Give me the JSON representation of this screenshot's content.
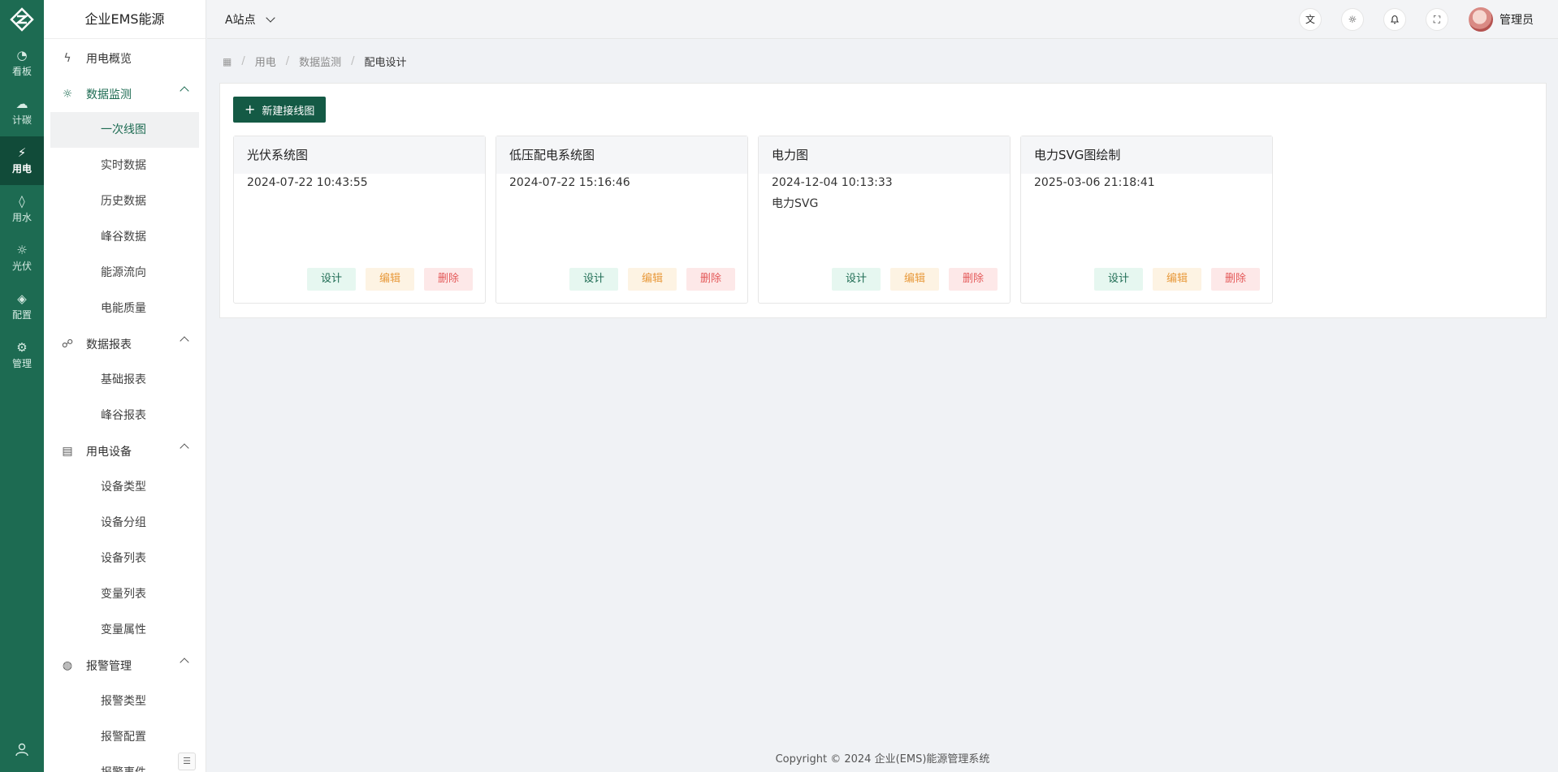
{
  "app": {
    "title": "企业EMS能源"
  },
  "rail": [
    {
      "label": "看板",
      "icon": "pie-chart-icon"
    },
    {
      "label": "计碳",
      "icon": "cloud-icon"
    },
    {
      "label": "用电",
      "icon": "plug-icon"
    },
    {
      "label": "用水",
      "icon": "water-drop-icon"
    },
    {
      "label": "光伏",
      "icon": "sun-icon"
    },
    {
      "label": "配置",
      "icon": "config-icon"
    },
    {
      "label": "管理",
      "icon": "gear-icon"
    }
  ],
  "menu": {
    "overview": "用电概览",
    "monitor": {
      "label": "数据监测",
      "items": [
        "一次线图",
        "实时数据",
        "历史数据",
        "峰谷数据",
        "能源流向",
        "电能质量"
      ]
    },
    "report": {
      "label": "数据报表",
      "items": [
        "基础报表",
        "峰谷报表"
      ]
    },
    "device": {
      "label": "用电设备",
      "items": [
        "设备类型",
        "设备分组",
        "设备列表",
        "变量列表",
        "变量属性"
      ]
    },
    "alarm": {
      "label": "报警管理",
      "items": [
        "报警类型",
        "报警配置",
        "报警事件"
      ]
    }
  },
  "header": {
    "site": "A站点",
    "user_name": "管理员"
  },
  "breadcrumb": {
    "items": [
      "用电",
      "数据监测"
    ],
    "current": "配电设计"
  },
  "toolbar": {
    "new_label": "新建接线图"
  },
  "actions": {
    "design": "设计",
    "edit": "编辑",
    "delete": "删除"
  },
  "cards": [
    {
      "title": "光伏系统图",
      "time": "2024-07-22 10:43:55",
      "desc": ""
    },
    {
      "title": "低压配电系统图",
      "time": "2024-07-22 15:16:46",
      "desc": ""
    },
    {
      "title": "电力图",
      "time": "2024-12-04 10:13:33",
      "desc": "电力SVG"
    },
    {
      "title": "电力SVG图绘制",
      "time": "2025-03-06 21:18:41",
      "desc": ""
    }
  ],
  "footer": {
    "text": "Copyright © 2024 企业(EMS)能源管理系统"
  },
  "colors": {
    "primary": "#1d6b52",
    "rail_bg": "#1d6b52",
    "button": "#145a45"
  }
}
